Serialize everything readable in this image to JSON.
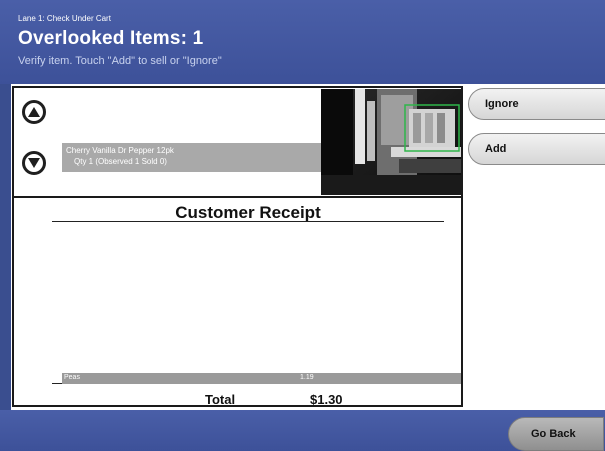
{
  "header": {
    "lane": "Lane 1: Check Under Cart",
    "title": "Overlooked Items: 1",
    "instruction": "Verify item. Touch \"Add\" to sell or \"Ignore\""
  },
  "item": {
    "name": "Cherry Vanilla Dr Pepper 12pk",
    "qty": "Qty 1 (Observed 1 Sold 0)"
  },
  "receipt": {
    "title": "Customer Receipt",
    "items": [
      {
        "name": "Peas",
        "price": "1.19"
      }
    ],
    "total_label": "Total",
    "total_value": "$1.30"
  },
  "actions": {
    "ignore_label": "Ignore",
    "add_label": "Add",
    "go_back_label": "Go Back"
  },
  "colors": {
    "header_blue": "#3d5199",
    "item_strip": "#a9a9a9",
    "camera_highlight": "#2fb64a"
  },
  "icons": {
    "scroll_up": "arrow-up-icon",
    "scroll_down": "arrow-down-icon"
  }
}
